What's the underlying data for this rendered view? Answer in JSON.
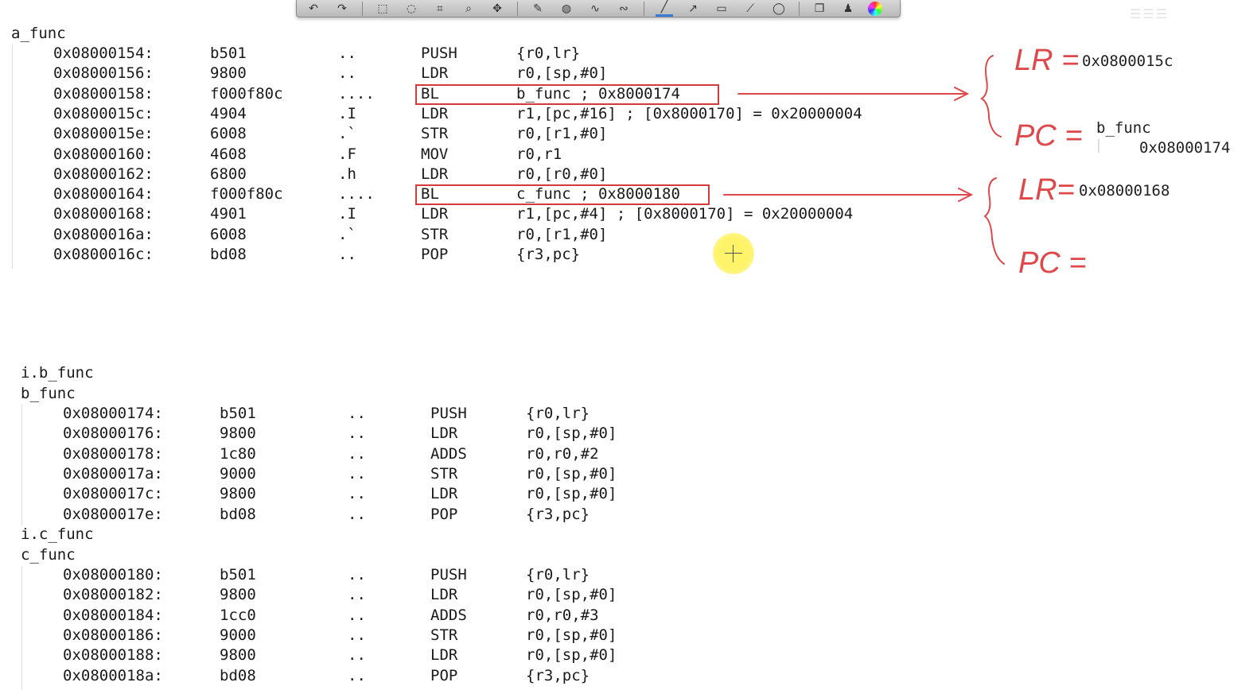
{
  "toolbar": {
    "icons": [
      "undo-icon",
      "redo-icon",
      "select-rect-icon",
      "lasso-icon",
      "crop-icon",
      "zoom-icon",
      "move-icon",
      "pen-icon",
      "highlighter-icon",
      "spiral-icon",
      "curve-icon",
      "line-icon",
      "arrow-icon",
      "rectangle-icon",
      "freehand-icon",
      "ellipse-icon",
      "copy-icon",
      "presenter-icon",
      "color-wheel-icon"
    ]
  },
  "a_func": {
    "label": "a_func",
    "rows": [
      {
        "addr": "0x08000154:",
        "hex": "b501",
        "ascii": "..",
        "op": "PUSH",
        "args": "{r0,lr}"
      },
      {
        "addr": "0x08000156:",
        "hex": "9800",
        "ascii": "..",
        "op": "LDR",
        "args": "r0,[sp,#0]"
      },
      {
        "addr": "0x08000158:",
        "hex": "f000f80c",
        "ascii": "....",
        "op": "BL",
        "args": "b_func ; 0x8000174"
      },
      {
        "addr": "0x0800015c:",
        "hex": "4904",
        "ascii": ".I",
        "op": "LDR",
        "args": "r1,[pc,#16] ; [0x8000170] = 0x20000004"
      },
      {
        "addr": "0x0800015e:",
        "hex": "6008",
        "ascii": ".`",
        "op": "STR",
        "args": "r0,[r1,#0]"
      },
      {
        "addr": "0x08000160:",
        "hex": "4608",
        "ascii": ".F",
        "op": "MOV",
        "args": "r0,r1"
      },
      {
        "addr": "0x08000162:",
        "hex": "6800",
        "ascii": ".h",
        "op": "LDR",
        "args": "r0,[r0,#0]"
      },
      {
        "addr": "0x08000164:",
        "hex": "f000f80c",
        "ascii": "....",
        "op": "BL",
        "args": "c_func ; 0x8000180"
      },
      {
        "addr": "0x08000168:",
        "hex": "4901",
        "ascii": ".I",
        "op": "LDR",
        "args": "r1,[pc,#4] ; [0x8000170] = 0x20000004"
      },
      {
        "addr": "0x0800016a:",
        "hex": "6008",
        "ascii": ".`",
        "op": "STR",
        "args": "r0,[r1,#0]"
      },
      {
        "addr": "0x0800016c:",
        "hex": "bd08",
        "ascii": "..",
        "op": "POP",
        "args": "{r3,pc}"
      }
    ]
  },
  "b_section": {
    "section_label": "i.b_func",
    "label": "b_func",
    "rows": [
      {
        "addr": "0x08000174:",
        "hex": "b501",
        "ascii": "..",
        "op": "PUSH",
        "args": "{r0,lr}"
      },
      {
        "addr": "0x08000176:",
        "hex": "9800",
        "ascii": "..",
        "op": "LDR",
        "args": "r0,[sp,#0]"
      },
      {
        "addr": "0x08000178:",
        "hex": "1c80",
        "ascii": "..",
        "op": "ADDS",
        "args": "r0,r0,#2"
      },
      {
        "addr": "0x0800017a:",
        "hex": "9000",
        "ascii": "..",
        "op": "STR",
        "args": "r0,[sp,#0]"
      },
      {
        "addr": "0x0800017c:",
        "hex": "9800",
        "ascii": "..",
        "op": "LDR",
        "args": "r0,[sp,#0]"
      },
      {
        "addr": "0x0800017e:",
        "hex": "bd08",
        "ascii": "..",
        "op": "POP",
        "args": "{r3,pc}"
      }
    ]
  },
  "c_section": {
    "section_label": "i.c_func",
    "label": "c_func",
    "rows": [
      {
        "addr": "0x08000180:",
        "hex": "b501",
        "ascii": "..",
        "op": "PUSH",
        "args": "{r0,lr}"
      },
      {
        "addr": "0x08000182:",
        "hex": "9800",
        "ascii": "..",
        "op": "LDR",
        "args": "r0,[sp,#0]"
      },
      {
        "addr": "0x08000184:",
        "hex": "1cc0",
        "ascii": "..",
        "op": "ADDS",
        "args": "r0,r0,#3"
      },
      {
        "addr": "0x08000186:",
        "hex": "9000",
        "ascii": "..",
        "op": "STR",
        "args": "r0,[sp,#0]"
      },
      {
        "addr": "0x08000188:",
        "hex": "9800",
        "ascii": "..",
        "op": "LDR",
        "args": "r0,[sp,#0]"
      },
      {
        "addr": "0x0800018a:",
        "hex": "bd08",
        "ascii": "..",
        "op": "POP",
        "args": "{r3,pc}"
      }
    ]
  },
  "annotations": {
    "lr1_label": "LR =",
    "lr1_value": "0x0800015c",
    "pc1_label": "PC =",
    "pc1_value_name": "b_func",
    "pc1_value_addr": "0x08000174",
    "lr2_label": "LR=",
    "lr2_value": "0x08000168",
    "pc2_label": "PC ="
  },
  "colors": {
    "annotation_red": "#e0474a",
    "highlight_box": "#d43a3a",
    "cursor_yellow": "#fff36a"
  }
}
